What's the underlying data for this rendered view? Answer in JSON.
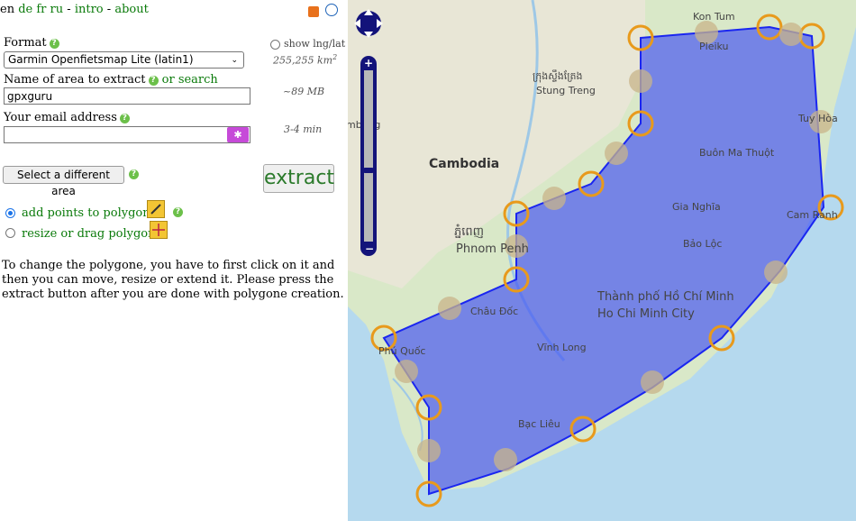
{
  "nav": {
    "lang_current": "en",
    "lang_de": "de",
    "lang_fr": "fr",
    "lang_ru": "ru",
    "sep1": "-",
    "intro": "intro",
    "sep2": "-",
    "about": "about"
  },
  "form": {
    "format_label": "Format",
    "format_value": "Garmin Openfietsmap Lite (latin1)",
    "show_lnglat": "show lng/lat",
    "coords": "255,255 km",
    "coords_sup": "2",
    "name_label": "Name of area to extract",
    "or_search": "or search",
    "name_value": "gpxguru",
    "size_est": "~89 MB",
    "email_label": "Your email address",
    "email_value": "",
    "time_est": "3-4 min",
    "select_area_button": "Select a different area",
    "extract_button": "extract",
    "add_points_label": "add points to polygon",
    "resize_label": "resize or drag polygon",
    "help_text": "To change the polygone, you have to first click on it and then you can move, resize or extend it. Please press the extract button after you are done with polygone creation."
  },
  "map": {
    "places": [
      "Kon Tum",
      "Pleiku",
      "ក្រុងស្ទឹងត្រែង",
      "Stung Treng",
      "Tuy Hòa",
      "Buôn Ma Thuột",
      "Cambodia",
      "Gia Nghĩa",
      "Cam Ranh",
      "ភ្នំពេញ",
      "Phnom Penh",
      "Bảo Lộc",
      "Thành phố Hồ Chí Minh",
      "Ho Chi Minh City",
      "Châu Đốc",
      "Vĩnh Long",
      "Phú Quốc",
      "Bạc Liêu",
      "mbang"
    ]
  }
}
